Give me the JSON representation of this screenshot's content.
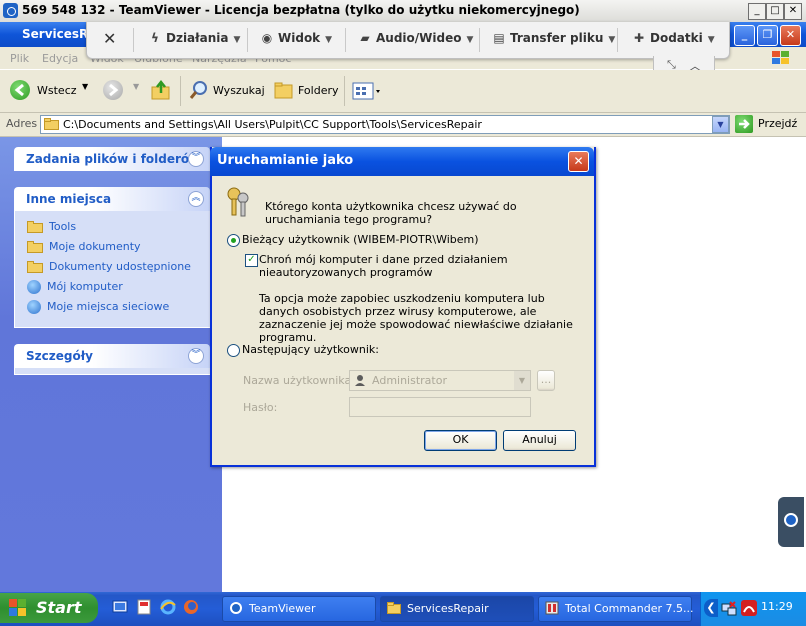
{
  "teamviewer": {
    "window_title": "569 548 132 - TeamViewer - Licencja bezpłatna (tylko do użytku niekomercyjnego)",
    "toolbar": {
      "close_symbol": "✕",
      "items": [
        {
          "label": "Działania",
          "icon": "lightning-icon"
        },
        {
          "label": "Widok",
          "icon": "eye-icon"
        },
        {
          "label": "Audio/Wideo",
          "icon": "chat-icon"
        },
        {
          "label": "Transfer pliku",
          "icon": "file-transfer-icon"
        },
        {
          "label": "Dodatki",
          "icon": "puzzle-icon"
        }
      ]
    }
  },
  "explorer": {
    "window_title": "ServicesRe",
    "menu": [
      "Plik",
      "Edycja",
      "Widok",
      "Ulubione",
      "Narzędzia",
      "Pomoc"
    ],
    "toolbar": {
      "back": "Wstecz",
      "search": "Wyszukaj",
      "folders": "Foldery"
    },
    "address": {
      "label": "Adres",
      "path": "C:\\Documents and Settings\\All Users\\Pulpit\\CC Support\\Tools\\ServicesRepair",
      "go": "Przejdź"
    },
    "left_panel": {
      "tasks_title": "Zadania plików i folderów",
      "places_title": "Inne miejsca",
      "places": [
        "Tools",
        "Moje dokumenty",
        "Dokumenty udostępnione",
        "Mój komputer",
        "Moje miejsca sieciowe"
      ],
      "details_title": "Szczegóły"
    }
  },
  "dialog": {
    "title": "Uruchamianie jako",
    "question": "Którego konta użytkownika chcesz używać do uruchamiania tego programu?",
    "option_current": "Bieżący użytkownik (WIBEM-PIOTR\\Wibem)",
    "protect_label": "Chroń mój komputer i dane przed działaniem nieautoryzowanych programów",
    "protect_checked": true,
    "info": "Ta opcja może zapobiec uszkodzeniu komputera lub danych osobistych przez wirusy komputerowe, ale zaznaczenie jej może spowodować niewłaściwe działanie programu.",
    "option_other": "Następujący użytkownik:",
    "username_label": "Nazwa użytkownika:",
    "username_value": "Administrator",
    "browse": "...",
    "password_label": "Hasło:",
    "ok": "OK",
    "cancel": "Anuluj"
  },
  "taskbar": {
    "start": "Start",
    "tasks": [
      {
        "label": "TeamViewer",
        "icon": "teamviewer-icon"
      },
      {
        "label": "ServicesRepair",
        "icon": "folder-icon"
      },
      {
        "label": "Total Commander 7.5...",
        "icon": "total-commander-icon"
      }
    ],
    "clock": "11:29"
  },
  "colors": {
    "xp_blue": "#0a52e0",
    "panel_blue": "#6278dc",
    "start_green": "#3c9a3c"
  }
}
